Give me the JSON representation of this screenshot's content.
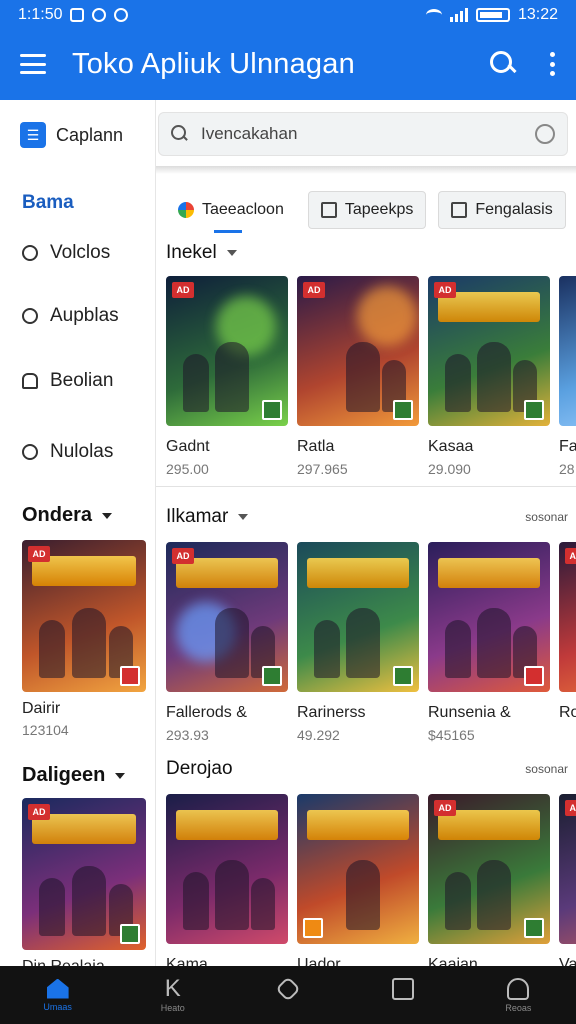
{
  "status_bar": {
    "time_left": "1:1:50",
    "time_right": "13:22"
  },
  "app_bar": {
    "title": "Toko Apliuk Ulnnagan"
  },
  "sidebar": {
    "top_label": "Caplann",
    "section_title": "Bama",
    "items": [
      {
        "label": "Volclos",
        "icon": "tag-icon"
      },
      {
        "label": "Aupblas",
        "icon": "apps-icon"
      },
      {
        "label": "Beolian",
        "icon": "bell-icon"
      },
      {
        "label": "Nulolas",
        "icon": "clock-icon"
      }
    ],
    "groups": [
      {
        "title": "Ondera",
        "card": {
          "name": "Dairir",
          "price": "123104",
          "badge": "AD",
          "colors": [
            "#3a1e2e",
            "#c0562a",
            "#f2a540"
          ]
        }
      },
      {
        "title": "Daligeen",
        "card": {
          "name": "Din Realaia",
          "price": "",
          "badge": "AD",
          "colors": [
            "#1a2a5e",
            "#7b2f7a",
            "#e0622a"
          ]
        }
      }
    ]
  },
  "search": {
    "placeholder": "Ivencakahan"
  },
  "chips": [
    {
      "label": "Taeeacloon",
      "active": true
    },
    {
      "label": "Tapeekps",
      "active": false
    },
    {
      "label": "Fengalasis",
      "active": false
    }
  ],
  "rows": [
    {
      "title": "Inekel",
      "more": "",
      "cards": [
        {
          "name": "Gadnt",
          "price": "295.00",
          "badge": "AD",
          "colors": [
            "#0e1e3a",
            "#2e6b3a",
            "#7ad14a"
          ],
          "rating": "green"
        },
        {
          "name": "Ratla",
          "price": "297.965",
          "badge": "AD",
          "colors": [
            "#2a1a48",
            "#b0452f",
            "#f29a3a"
          ],
          "rating": "green"
        },
        {
          "name": "Kasaa",
          "price": "29.090",
          "badge": "AD",
          "colors": [
            "#1b3a68",
            "#3a7d3a",
            "#e3b23a"
          ],
          "rating": "green"
        },
        {
          "name": "Fa",
          "price": "28",
          "badge": "",
          "colors": [
            "#1a3060",
            "#5aa0e0",
            "#a0d0ff"
          ],
          "rating": ""
        }
      ]
    },
    {
      "title": "Ilkamar",
      "more": "sosonar",
      "cards": [
        {
          "name": "Fallerods &",
          "price": "293.93",
          "badge": "AD",
          "colors": [
            "#1d2a5a",
            "#6e3a7a",
            "#d06a3a"
          ],
          "rating": "green"
        },
        {
          "name": "Rarinerss",
          "price": "49.292",
          "badge": "",
          "colors": [
            "#1b4a5a",
            "#3d8a4a",
            "#f0c040"
          ],
          "rating": "green"
        },
        {
          "name": "Runsenia &",
          "price": "$45165",
          "badge": "",
          "colors": [
            "#2a1e5a",
            "#8a3a8a",
            "#e05a3a"
          ],
          "rating": "red"
        },
        {
          "name": "Ro",
          "price": "",
          "badge": "AD",
          "colors": [
            "#2a1a3a",
            "#c03a3a",
            "#f07a3a"
          ],
          "rating": ""
        }
      ]
    },
    {
      "title": "Derojao",
      "more": "sosonar",
      "cards": [
        {
          "name": "Kama",
          "price": "",
          "badge": "",
          "colors": [
            "#1a1e48",
            "#7a2a6a",
            "#d04a6a"
          ],
          "rating": ""
        },
        {
          "name": "Uador",
          "price": "",
          "badge": "",
          "colors": [
            "#1a3a6a",
            "#c04a2a",
            "#f0b040"
          ],
          "rating": "orange"
        },
        {
          "name": "Kaaian",
          "price": "",
          "badge": "AD",
          "colors": [
            "#3a1a2a",
            "#3a7a3a",
            "#e0a03a"
          ],
          "rating": "green"
        },
        {
          "name": "Va",
          "price": "",
          "badge": "AD",
          "colors": [
            "#1a1e30",
            "#5a3a7a",
            "#c05a5a"
          ],
          "rating": ""
        }
      ]
    }
  ],
  "bottom_nav": [
    {
      "label": "Umaas",
      "icon": "home-icon",
      "active": true
    },
    {
      "label": "Heato",
      "icon": "k-icon",
      "active": false
    },
    {
      "label": "",
      "icon": "home-outline-icon",
      "active": false
    },
    {
      "label": "",
      "icon": "recents-icon",
      "active": false
    },
    {
      "label": "Reoas",
      "icon": "account-icon",
      "active": false
    }
  ]
}
